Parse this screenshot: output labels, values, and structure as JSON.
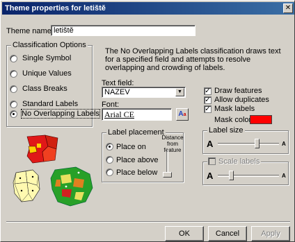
{
  "window": {
    "title": "Theme properties for letiště",
    "close_glyph": "✕"
  },
  "theme_name": {
    "label": "Theme name:",
    "value": "letiště"
  },
  "classification": {
    "legend": "Classification Options",
    "options": [
      "Single Symbol",
      "Unique Values",
      "Class Breaks",
      "Standard Labels",
      "No Overlapping Labels"
    ],
    "selected": "No Overlapping Labels"
  },
  "description": "The No Overlapping Labels classification draws text for a specified field and attempts to resolve overlapping and crowding of labels.",
  "text_field": {
    "label": "Text field:",
    "value": "NAZEV",
    "arrow": "▼"
  },
  "font": {
    "label": "Font:",
    "value": "Arial CE",
    "icon": "font-picker-icon"
  },
  "label_placement": {
    "legend": "Label placement",
    "options": [
      "Place on",
      "Place above",
      "Place below"
    ],
    "selected": "Place on",
    "distance_label": "Distance from feature"
  },
  "checks": {
    "draw_features": {
      "label": "Draw features",
      "checked": true
    },
    "allow_duplicates": {
      "label": "Allow duplicates",
      "checked": true
    },
    "mask_labels": {
      "label": "Mask labels",
      "checked": true
    },
    "mask_color_label": "Mask color:",
    "mask_color": "#ff0000"
  },
  "label_size": {
    "legend": "Label size",
    "small_glyph": "A",
    "large_glyph": "A",
    "level": 0.65
  },
  "scale_labels": {
    "legend": "Scale labels",
    "checked": false,
    "small_glyph": "A",
    "large_glyph": "A",
    "level": 0.2
  },
  "buttons": {
    "ok": "OK",
    "cancel": "Cancel",
    "apply": "Apply"
  }
}
